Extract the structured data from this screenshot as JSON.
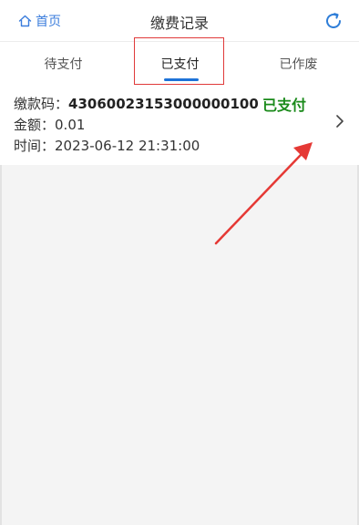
{
  "header": {
    "home_label": "首页",
    "title": "缴费记录"
  },
  "tabs": [
    {
      "label": "待支付",
      "active": false
    },
    {
      "label": "已支付",
      "active": true
    },
    {
      "label": "已作废",
      "active": false
    }
  ],
  "record": {
    "code_label": "缴款码：",
    "code_value": "43060023153000000100",
    "status": "已支付",
    "amount_label": "金额：",
    "amount_value": "0.01",
    "time_label": "时间：",
    "time_value": "2023-06-12 21:31:00"
  },
  "colors": {
    "accent": "#1e73d8",
    "status_paid": "#1a8a1a",
    "annotation": "#e03a3a"
  },
  "icons": {
    "home": "home-icon",
    "refresh": "refresh-icon",
    "chevron": "chevron-right-icon"
  }
}
